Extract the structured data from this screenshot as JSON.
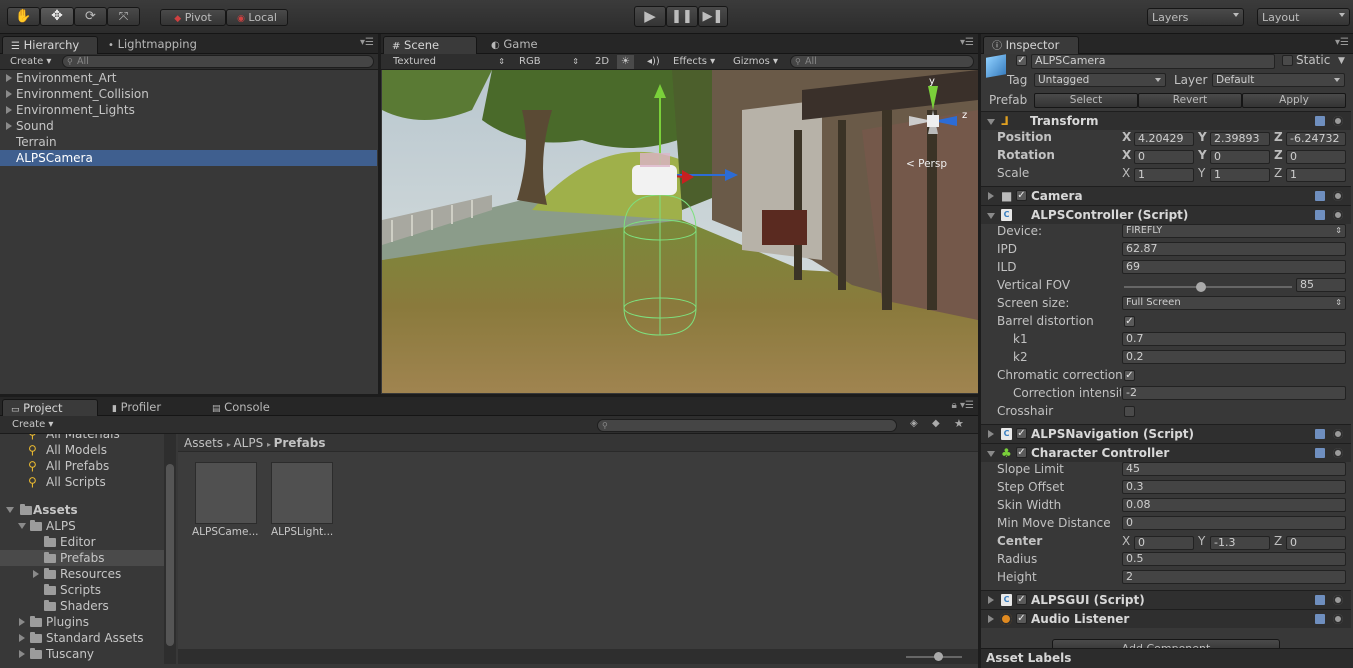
{
  "toolbar": {
    "pivot": "Pivot",
    "local": "Local",
    "layers": "Layers",
    "layout": "Layout"
  },
  "hierarchy": {
    "tab_label": "Hierarchy",
    "lightmap_tab": "Lightmapping",
    "create": "Create",
    "search_placeholder": "All",
    "items": [
      {
        "label": "Environment_Art",
        "expandable": true
      },
      {
        "label": "Environment_Collision",
        "expandable": true
      },
      {
        "label": "Environment_Lights",
        "expandable": true
      },
      {
        "label": "Sound",
        "expandable": true
      },
      {
        "label": "Terrain",
        "expandable": false
      },
      {
        "label": "ALPSCamera",
        "expandable": false,
        "selected": true
      }
    ]
  },
  "scene": {
    "tab_label": "Scene",
    "game_tab": "Game",
    "shading": "Textured",
    "color_mode": "RGB",
    "mode_2d": "2D",
    "effects": "Effects",
    "gizmos": "Gizmos",
    "search_placeholder": "All",
    "persp": "< Persp",
    "axis_y": "y",
    "axis_z": "z"
  },
  "project": {
    "tabs": [
      "Project",
      "Profiler",
      "Console"
    ],
    "create": "Create",
    "favorites": [
      "All Materials",
      "All Models",
      "All Prefabs",
      "All Scripts"
    ],
    "tree": {
      "assets": "Assets",
      "alps": "ALPS",
      "editor": "Editor",
      "prefabs": "Prefabs",
      "resources": "Resources",
      "scripts": "Scripts",
      "shaders": "Shaders",
      "plugins": "Plugins",
      "standard_assets": "Standard Assets",
      "tuscany": "Tuscany"
    },
    "breadcrumb": [
      "Assets",
      "ALPS",
      "Prefabs"
    ],
    "assets": [
      "ALPSCame...",
      "ALPSLight..."
    ]
  },
  "inspector": {
    "tab_label": "Inspector",
    "object_name": "ALPSCamera",
    "static_label": "Static",
    "tag_label": "Tag",
    "tag_value": "Untagged",
    "layer_label": "Layer",
    "layer_value": "Default",
    "prefab_label": "Prefab",
    "prefab_select": "Select",
    "prefab_revert": "Revert",
    "prefab_apply": "Apply",
    "transform": {
      "title": "Transform",
      "position_label": "Position",
      "rotation_label": "Rotation",
      "scale_label": "Scale",
      "position": [
        "4.20429",
        "2.39893",
        "-6.24732"
      ],
      "rotation": [
        "0",
        "0",
        "0"
      ],
      "scale": [
        "1",
        "1",
        "1"
      ],
      "x": "X",
      "y": "Y",
      "z": "Z"
    },
    "camera_title": "Camera",
    "alps_controller": {
      "title": "ALPSController (Script)",
      "device_label": "Device:",
      "device": "FIREFLY",
      "ipd_label": "IPD",
      "ipd": "62.87",
      "ild_label": "ILD",
      "ild": "69",
      "fov_label": "Vertical FOV",
      "fov": "85",
      "fov_fraction": 0.46,
      "screen_label": "Screen size:",
      "screen": "Full Screen",
      "barrel_label": "Barrel distortion",
      "k1_label": "k1",
      "k1": "0.7",
      "k2_label": "k2",
      "k2": "0.2",
      "chrom_label": "Chromatic correction",
      "corr_label": "Correction intensity",
      "corr": "-2",
      "crosshair_label": "Crosshair"
    },
    "alps_navigation_title": "ALPSNavigation (Script)",
    "character_controller": {
      "title": "Character Controller",
      "slope_label": "Slope Limit",
      "slope": "45",
      "step_label": "Step Offset",
      "step": "0.3",
      "skin_label": "Skin Width",
      "skin": "0.08",
      "minmove_label": "Min Move Distance",
      "minmove": "0",
      "center_label": "Center",
      "center": [
        "0",
        "-1.3",
        "0"
      ],
      "radius_label": "Radius",
      "radius": "0.5",
      "height_label": "Height",
      "height": "2"
    },
    "alps_gui_title": "ALPSGUI (Script)",
    "audio_listener_title": "Audio Listener",
    "add_component": "Add Component",
    "asset_labels": "Asset Labels"
  },
  "colors": {
    "selection": "#3f5f8f",
    "panel": "#383838",
    "accent": "#e0a020"
  }
}
